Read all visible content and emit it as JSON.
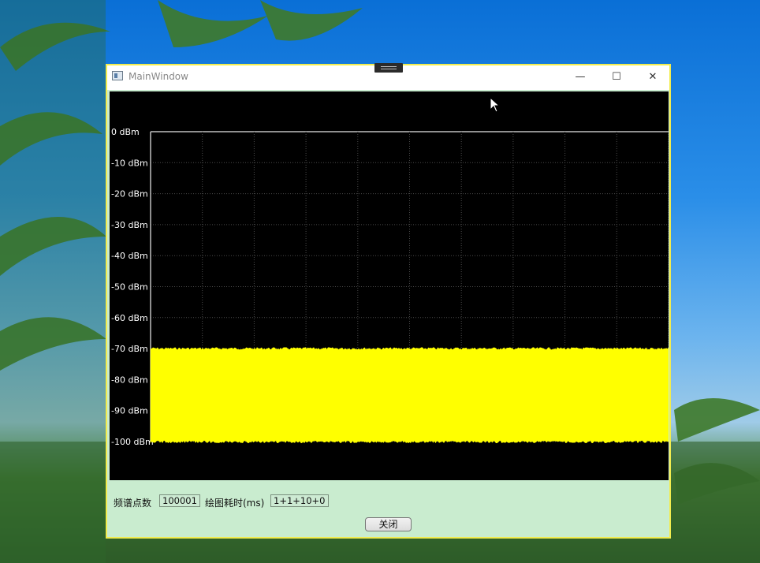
{
  "window": {
    "title": "MainWindow",
    "controls": {
      "minimize": "—",
      "maximize": "☐",
      "close": "✕"
    }
  },
  "chart_data": {
    "type": "area",
    "ylabel_unit": "dBm",
    "y_ticks": [
      "0 dBm",
      "-10 dBm",
      "-20 dBm",
      "-30 dBm",
      "-40 dBm",
      "-50 dBm",
      "-60 dBm",
      "-70 dBm",
      "-80 dBm",
      "-90 dBm",
      "-100 dBm"
    ],
    "ylim": [
      -100,
      0
    ],
    "x_divisions": 10,
    "grid": true,
    "series": [
      {
        "color": "#ffff00",
        "band_low_dbm": -100,
        "band_high_dbm": -70,
        "points": 100001
      }
    ],
    "background": "#000000"
  },
  "footer": {
    "points_label": "频谱点数",
    "points_value": "100001",
    "time_label": "绘图耗时(ms)",
    "time_value": "1+1+10+0",
    "close_button": "关闭"
  }
}
